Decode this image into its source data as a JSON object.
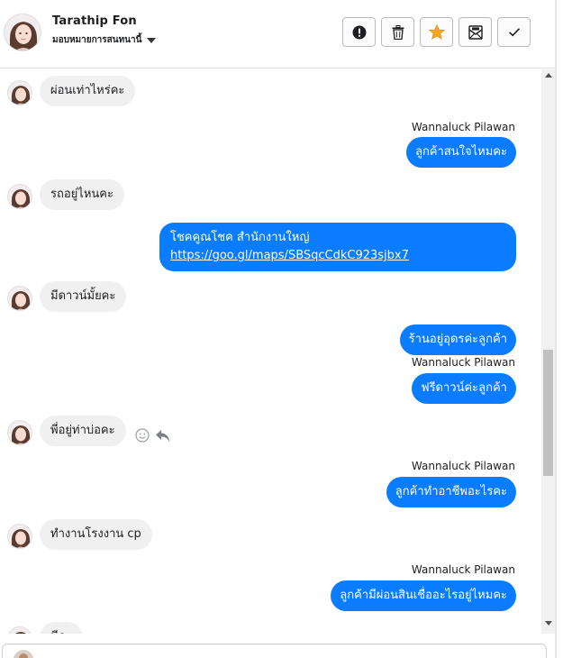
{
  "header": {
    "contact_name": "Tarathip Fon",
    "assign_label": "มอบหมายการสนทนานี้",
    "buttons": [
      {
        "icon": "alert-icon",
        "label": "Mark as spam"
      },
      {
        "icon": "trash-icon",
        "label": "Delete"
      },
      {
        "icon": "star-icon",
        "label": "Star"
      },
      {
        "icon": "mark-unread-icon",
        "label": "Mark as unread"
      },
      {
        "icon": "checkmark-icon",
        "label": "Mark as done"
      }
    ]
  },
  "messages": [
    {
      "dir": "in",
      "text": "ผ่อนเท่าไหร่คะ"
    },
    {
      "dir": "out",
      "sender": "Wannaluck Pilawan",
      "text": "ลูกค้าสนใจไหมคะ"
    },
    {
      "dir": "in",
      "text": "รถอยู่ไหนคะ"
    },
    {
      "dir": "out",
      "text_line1": "โชคคูณโชค สำนักงานใหญ่",
      "link": "https://goo.gl/maps/SBSqcCdkC923sjbx7"
    },
    {
      "dir": "in",
      "text": "มีดาวน์มั้ยคะ"
    },
    {
      "dir": "out",
      "text": "ร้านอยู่อุดรค่ะลูกค้า"
    },
    {
      "dir": "out",
      "sender": "Wannaluck Pilawan",
      "text": "ฟรีดาวน์ค่ะลูกค้า"
    },
    {
      "dir": "in",
      "text": "พี่อยู่ท่าบ่อคะ"
    },
    {
      "dir": "out",
      "sender": "Wannaluck Pilawan",
      "text": "ลูกค้าทำอาชีพอะไรคะ"
    },
    {
      "dir": "in",
      "text": "ทำงานโรงงาน cp"
    },
    {
      "dir": "out",
      "sender": "Wannaluck Pilawan",
      "text": "ลูกค้ามีผ่อนสินเชื่ออะไรอยู่ไหมคะ"
    },
    {
      "dir": "in",
      "text": "มีคะ"
    }
  ],
  "colors": {
    "outgoing_bubble": "#0a7cff",
    "incoming_bubble": "#f0f0f0",
    "star": "#f5a623"
  }
}
